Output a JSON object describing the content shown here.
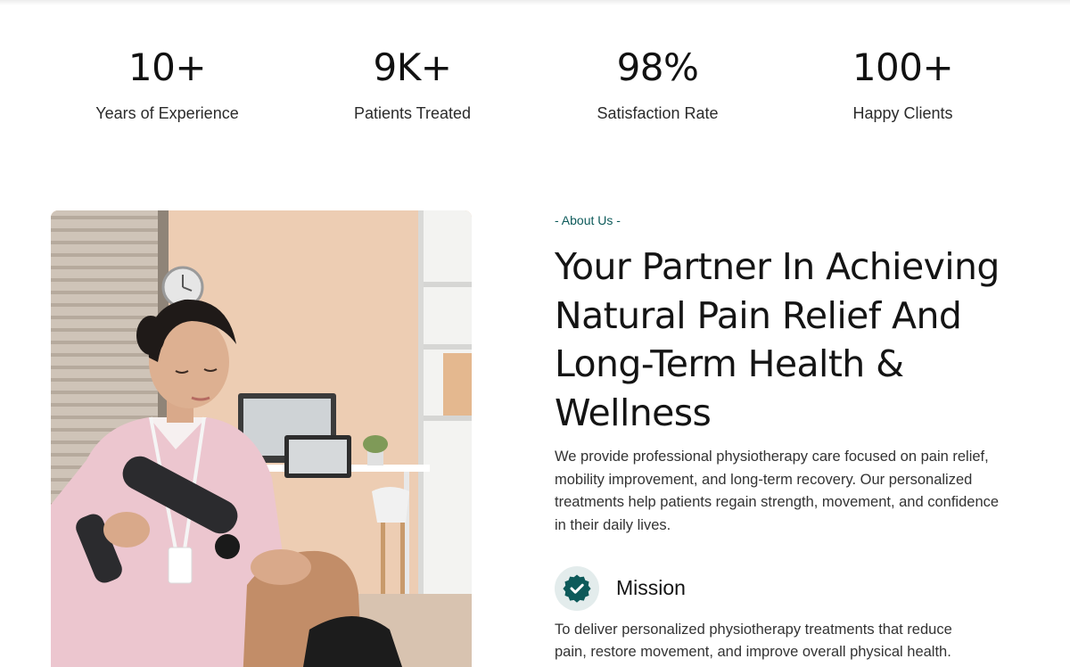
{
  "stats": [
    {
      "value": "10+",
      "label": "Years of Experience"
    },
    {
      "value": "9K+",
      "label": "Patients Treated"
    },
    {
      "value": "98%",
      "label": "Satisfaction Rate"
    },
    {
      "value": "100+",
      "label": "Happy Clients"
    }
  ],
  "about": {
    "eyebrow": "- About Us -",
    "headline": "Your Partner In Achieving Natural Pain Relief And Long-Term Health & Wellness",
    "description": "We provide professional physiotherapy care focused on pain relief, mobility improvement, and long-term recovery. Our personalized treatments help patients regain strength, movement, and confidence in their daily lives.",
    "mission": {
      "icon": "verified-badge-icon",
      "title": "Mission",
      "text": "To deliver personalized physiotherapy treatments that reduce pain, restore movement, and improve overall physical health."
    }
  },
  "colors": {
    "accent": "#0d5a5a",
    "badge_bg": "#e3ecec"
  }
}
